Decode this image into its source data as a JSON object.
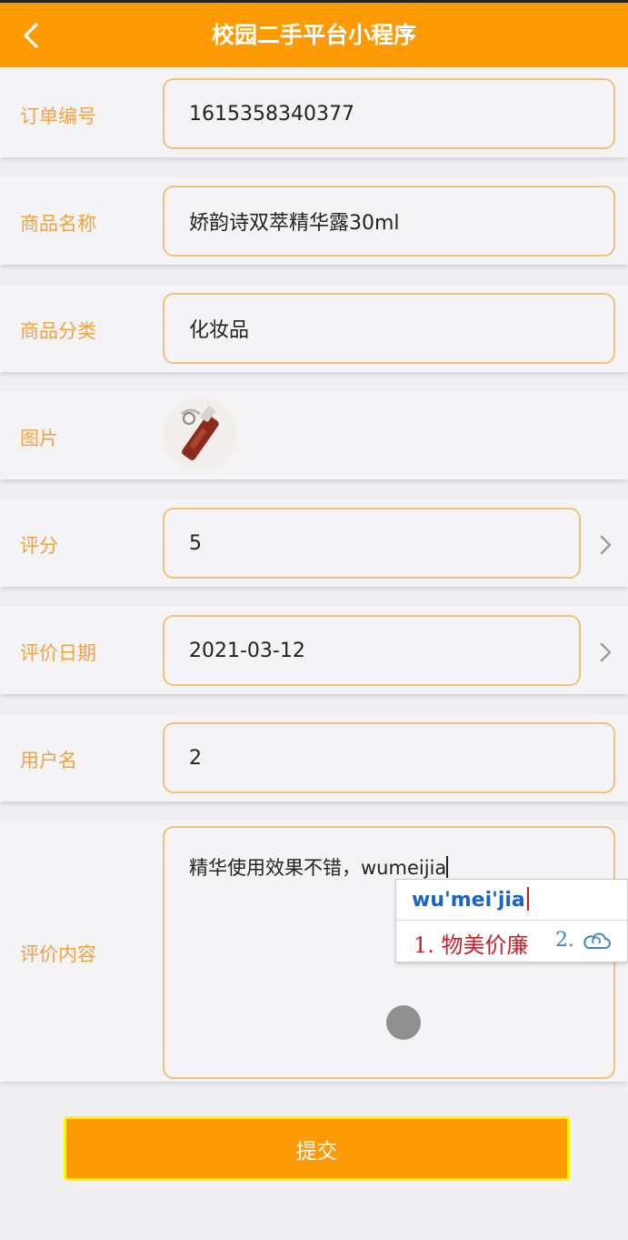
{
  "header": {
    "title": "校园二手平台小程序"
  },
  "form": {
    "order_no": {
      "label": "订单编号",
      "value": "1615358340377"
    },
    "product_name": {
      "label": "商品名称",
      "value": "娇韵诗双萃精华露30ml"
    },
    "category": {
      "label": "商品分类",
      "value": "化妆品"
    },
    "image": {
      "label": "图片"
    },
    "rating": {
      "label": "评分",
      "value": "5"
    },
    "review_date": {
      "label": "评价日期",
      "value": "2021-03-12"
    },
    "username": {
      "label": "用户名",
      "value": "2"
    },
    "review_content": {
      "label": "评价内容",
      "value": "精华使用效果不错，wumeijia"
    }
  },
  "ime": {
    "pinyin": "wu'mei'jia",
    "candidate_1": "1. 物美价廉",
    "candidate_2": "2."
  },
  "submit_label": "提交",
  "colors": {
    "accent": "#fe9a03",
    "label": "#f3a241",
    "border": "#f0c277",
    "highlight": "#fef20a"
  }
}
